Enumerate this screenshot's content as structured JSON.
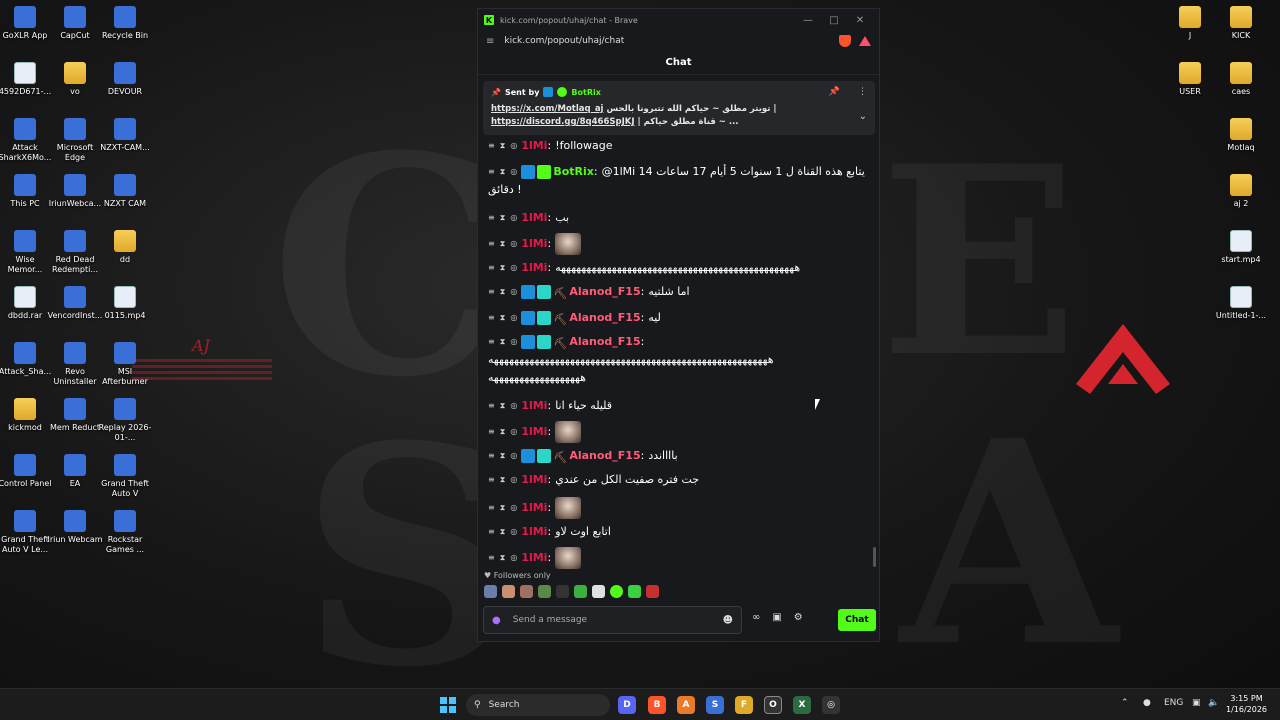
{
  "desktop": {
    "left_icons": [
      {
        "label": "GoXLR App",
        "icon": "goxlr-icon"
      },
      {
        "label": "CapCut",
        "icon": "capcut-icon"
      },
      {
        "label": "Recycle Bin",
        "icon": "recycle-bin-icon"
      },
      {
        "label": "4592D671-...",
        "icon": "file-icon"
      },
      {
        "label": "vo",
        "icon": "folder-icon"
      },
      {
        "label": "DEVOUR",
        "icon": "devour-icon"
      },
      {
        "label": "Attack SharkX6Mo...",
        "icon": "attack-shark-icon"
      },
      {
        "label": "Microsoft Edge",
        "icon": "edge-icon"
      },
      {
        "label": "NZXT-CAM...",
        "icon": "nzxt-icon"
      },
      {
        "label": "This PC",
        "icon": "this-pc-icon"
      },
      {
        "label": "IriunWebca...",
        "icon": "iriun-icon"
      },
      {
        "label": "NZXT CAM",
        "icon": "nzxt-icon"
      },
      {
        "label": "Wise Memor...",
        "icon": "wise-memory-icon"
      },
      {
        "label": "Red Dead Redempti...",
        "icon": "rdr-icon"
      },
      {
        "label": "dd",
        "icon": "folder-icon"
      },
      {
        "label": "dbdd.rar",
        "icon": "rar-icon"
      },
      {
        "label": "VencordInst...",
        "icon": "vencord-icon"
      },
      {
        "label": "0115.mp4",
        "icon": "video-file-icon"
      },
      {
        "label": "Attack_Sha...",
        "icon": "attack-shark-icon"
      },
      {
        "label": "Revo Uninstaller",
        "icon": "revo-icon"
      },
      {
        "label": "MSI Afterburner",
        "icon": "msi-icon"
      },
      {
        "label": "kickmod",
        "icon": "folder-icon"
      },
      {
        "label": "Mem Reduct",
        "icon": "mem-reduct-icon"
      },
      {
        "label": "Replay 2026-01-...",
        "icon": "replay-icon"
      },
      {
        "label": "Control Panel",
        "icon": "control-panel-icon"
      },
      {
        "label": "EA",
        "icon": "ea-icon"
      },
      {
        "label": "Grand Theft Auto V",
        "icon": "gta-icon"
      },
      {
        "label": "Grand Theft Auto V Le...",
        "icon": "gta-icon"
      },
      {
        "label": "Iriun Webcam",
        "icon": "iriun-icon"
      },
      {
        "label": "Rockstar Games ...",
        "icon": "rockstar-icon"
      }
    ],
    "right_icons": [
      {
        "label": "J",
        "icon": "folder-icon"
      },
      {
        "label": "KICK",
        "icon": "folder-icon"
      },
      {
        "label": "USER",
        "icon": "folder-icon"
      },
      {
        "label": "caes",
        "icon": "folder-icon"
      },
      {
        "label": "Motlaq",
        "icon": "folder-icon"
      },
      {
        "label": "aj 2",
        "icon": "folder-icon"
      },
      {
        "label": "start.mp4",
        "icon": "video-file-icon"
      },
      {
        "label": "Untitled-1-...",
        "icon": "video-file-icon"
      }
    ],
    "wallpaper_text": "AJ"
  },
  "browser": {
    "tab_title": "kick.com/popout/uhaj/chat - Brave",
    "url": "kick.com/popout/uhaj/chat",
    "chat_title": "Chat",
    "pinned": {
      "sent_by_label": "Sent by",
      "sender": "BotRix",
      "line1_link": "https://x.com/Motlaq_aj",
      "line1_text": "تويتر مطلق ~ حياكم الله تتبرونا بالحس |",
      "line2_link": "https://discord.gg/8q466SpJKJ",
      "line2_text": "| قناة مطلق حياكم ~ ..."
    },
    "messages": [
      {
        "user": "1lMi",
        "sep": ":",
        "text": "!followage",
        "user_color": "red",
        "emote": false
      },
      {
        "user": "BotRix",
        "sep": ":",
        "text": "@1lMi 14 يتابع هذه القناة ل 1 سنوات 5 أيام 17 ساعات",
        "text2": "دقائق !",
        "user_color": "green",
        "emote": false
      },
      {
        "user": "1lMi",
        "sep": ":",
        "text": "بب",
        "user_color": "red",
        "emote": false
      },
      {
        "user": "1lMi",
        "sep": ":",
        "text": "",
        "user_color": "red",
        "emote": true
      },
      {
        "user": "1lMi",
        "sep": ":",
        "text": "هههههههههههههههههههههههههههههههههههههههههههههههه",
        "user_color": "red",
        "emote": false
      },
      {
        "user": "Alanod_F15",
        "sep": ":",
        "text": "اما شلتيه",
        "user_color": "pink",
        "emote": false
      },
      {
        "user": "Alanod_F15",
        "sep": ":",
        "text": "ليه",
        "user_color": "pink",
        "emote": false
      },
      {
        "user": "Alanod_F15",
        "sep": ":",
        "text": "",
        "text2": "هههههههههههههههههههههههههههههههههههههههههههههههههههههههه",
        "text3": "ههههههههههههههههههه",
        "user_color": "pink",
        "emote": false
      },
      {
        "user": "1lMi",
        "sep": ":",
        "text": "قليله حياء انا",
        "user_color": "red",
        "emote": false
      },
      {
        "user": "1lMi",
        "sep": ":",
        "text": "",
        "user_color": "red",
        "emote": true
      },
      {
        "user": "Alanod_F15",
        "sep": ":",
        "text": "بااااندد",
        "user_color": "pink",
        "emote": false
      },
      {
        "user": "1lMi",
        "sep": ":",
        "text": "جت فتره صفيت الكل من عندي",
        "user_color": "red",
        "emote": false
      },
      {
        "user": "1lMi",
        "sep": ":",
        "text": "",
        "user_color": "red",
        "emote": true
      },
      {
        "user": "1lMi",
        "sep": ":",
        "text": "اتابع اوت لاو",
        "user_color": "red",
        "emote": false
      },
      {
        "user": "1lMi",
        "sep": ":",
        "text": "",
        "user_color": "red",
        "emote": true
      }
    ],
    "followers_only": "Followers only",
    "composer_placeholder": "Send a message",
    "chat_button": "Chat"
  },
  "taskbar": {
    "search_label": "Search",
    "lang": "ENG",
    "time": "3:15 PM",
    "date": "1/16/2026"
  },
  "colors": {
    "kick_green": "#53fc18",
    "user_red": "#e8194a",
    "user_pink": "#ff5c7a"
  }
}
